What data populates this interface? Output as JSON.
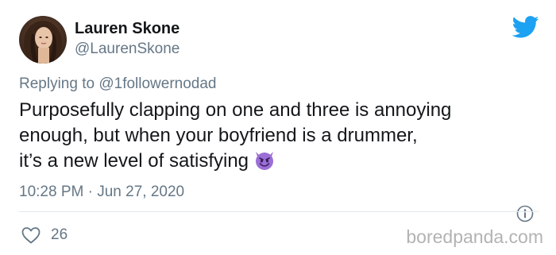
{
  "tweet": {
    "author": {
      "display_name": "Lauren Skone",
      "handle": "@LaurenSkone",
      "avatar": "profile-photo"
    },
    "reply": {
      "prefix": "Replying to ",
      "mention": "@1followernodad"
    },
    "body_lines": [
      "Purposefully clapping on one and three is annoying",
      "enough, but when your boyfriend is a drummer,",
      "it’s a new level of satisfying"
    ],
    "emoji": "smiling-imp-emoji",
    "time": "10:28 PM",
    "separator": "·",
    "date": "Jun 27, 2020",
    "likes": "26"
  },
  "icons": {
    "brand": "twitter-bird-icon",
    "info": "info-icon",
    "like": "heart-outline-icon"
  },
  "watermark": "boredpanda.com",
  "colors": {
    "twitter_blue": "#1da1f2",
    "text_primary": "#14171a",
    "text_secondary": "#657786",
    "divider": "#e1e8ed",
    "emoji_purple": "#9b6fd6",
    "watermark": "#b3b3b3"
  }
}
